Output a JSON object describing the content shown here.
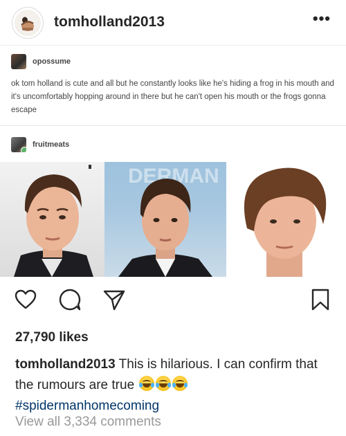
{
  "header": {
    "username": "tomholland2013",
    "more_label": "•••",
    "avatar_icon": "profile-photo-icon"
  },
  "tumblr": {
    "poster1": "opossume",
    "text": "ok tom holland is cute and all but he constantly looks like he's hiding a frog in his mouth and it's uncomfortably hopping around in there but he can't open his mouth or the frogs gonna escape",
    "poster2": "fruitmeats",
    "photo_bg_text": "DERMAN"
  },
  "actions": {
    "like_icon": "heart-icon",
    "comment_icon": "comment-icon",
    "share_icon": "send-icon",
    "save_icon": "bookmark-icon"
  },
  "likes": "27,790 likes",
  "caption": {
    "username": "tomholland2013",
    "text_line": "This is hilarious. I can confirm that the rumours are true",
    "emoji": "😂😂😂",
    "hashtag": "#spidermanhomecoming"
  },
  "view_all": "View all 3,334 comments",
  "colors": {
    "text": "#262626",
    "hashtag": "#003569",
    "muted": "#999999",
    "border": "#efefef"
  }
}
